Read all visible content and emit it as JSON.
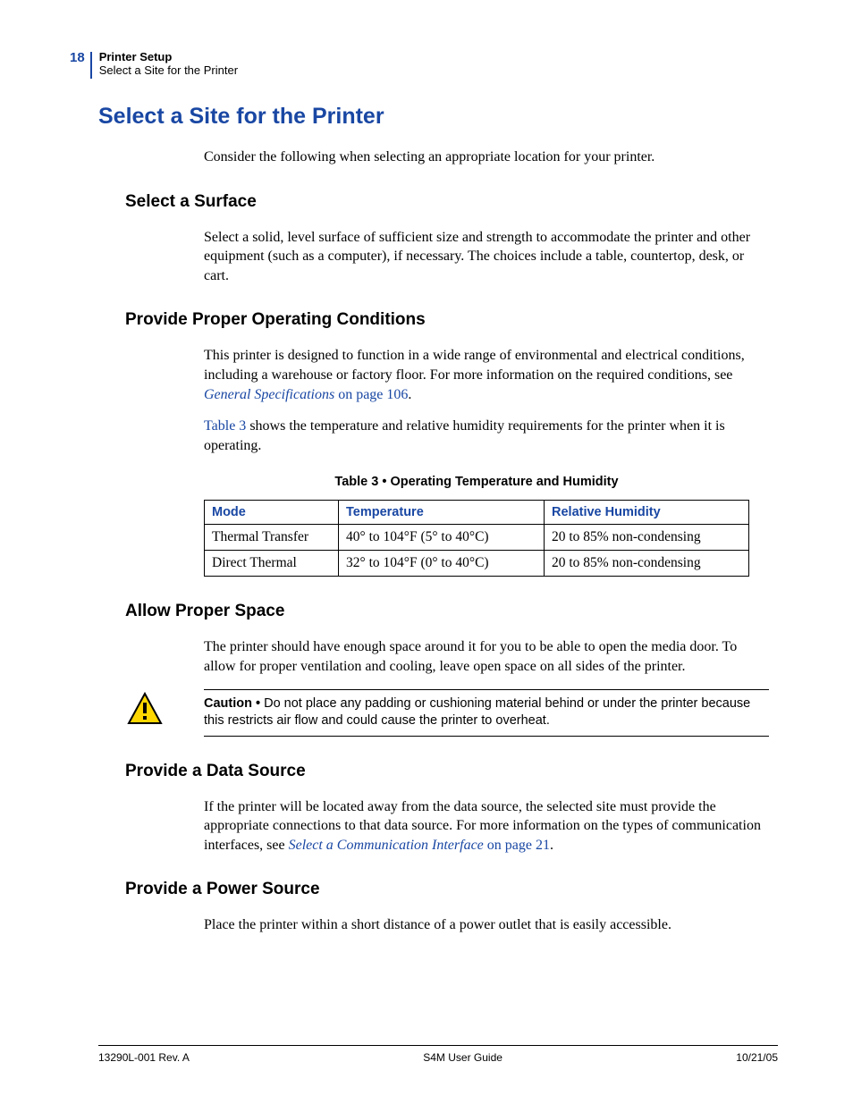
{
  "header": {
    "page_number": "18",
    "chapter": "Printer Setup",
    "section": "Select a Site for the Printer"
  },
  "title": "Select a Site for the Printer",
  "intro": "Consider the following when selecting an appropriate location for your printer.",
  "subsections": {
    "surface": {
      "heading": "Select a Surface",
      "body": "Select a solid, level surface of sufficient size and strength to accommodate the printer and other equipment (such as a computer), if necessary. The choices include a table, countertop, desk, or cart."
    },
    "conditions": {
      "heading": "Provide Proper Operating Conditions",
      "body_prefix": "This printer is designed to function in a wide range of environmental and electrical conditions, including a warehouse or factory floor. For more information on the required conditions, see ",
      "link1_italic": "General Specifications",
      "link1_plain": " on page 106",
      "body_suffix": ".",
      "para2_pre": "Table 3",
      "para2_rest": " shows the temperature and relative humidity requirements for the printer when it is operating."
    },
    "space": {
      "heading": "Allow Proper Space",
      "body": "The printer should have enough space around it for you to be able to open the media door. To allow for proper ventilation and cooling, leave open space on all sides of the printer."
    },
    "data_source": {
      "heading": "Provide a Data Source",
      "body_prefix": "If the printer will be located away from the data source, the selected site must provide the appropriate connections to that data source. For more information on the types of communication interfaces, see ",
      "link_italic": "Select a Communication Interface",
      "link_plain": " on page 21",
      "body_suffix": "."
    },
    "power": {
      "heading": "Provide a Power Source",
      "body": "Place the printer within a short distance of a power outlet that is easily accessible."
    }
  },
  "table": {
    "caption": "Table 3 • Operating Temperature and Humidity",
    "headers": {
      "mode": "Mode",
      "temp": "Temperature",
      "humidity": "Relative Humidity"
    },
    "rows": [
      {
        "mode": "Thermal Transfer",
        "temp": "40° to 104°F (5° to 40°C)",
        "humidity": "20 to 85% non-condensing"
      },
      {
        "mode": "Direct Thermal",
        "temp": "32° to 104°F (0° to 40°C)",
        "humidity": "20 to 85% non-condensing"
      }
    ]
  },
  "caution": {
    "label": "Caution • ",
    "text": " Do not place any padding or cushioning material behind or under the printer because this restricts air flow and could cause the printer to overheat."
  },
  "footer": {
    "left": "13290L-001 Rev. A",
    "center": "S4M User Guide",
    "right": "10/21/05"
  }
}
